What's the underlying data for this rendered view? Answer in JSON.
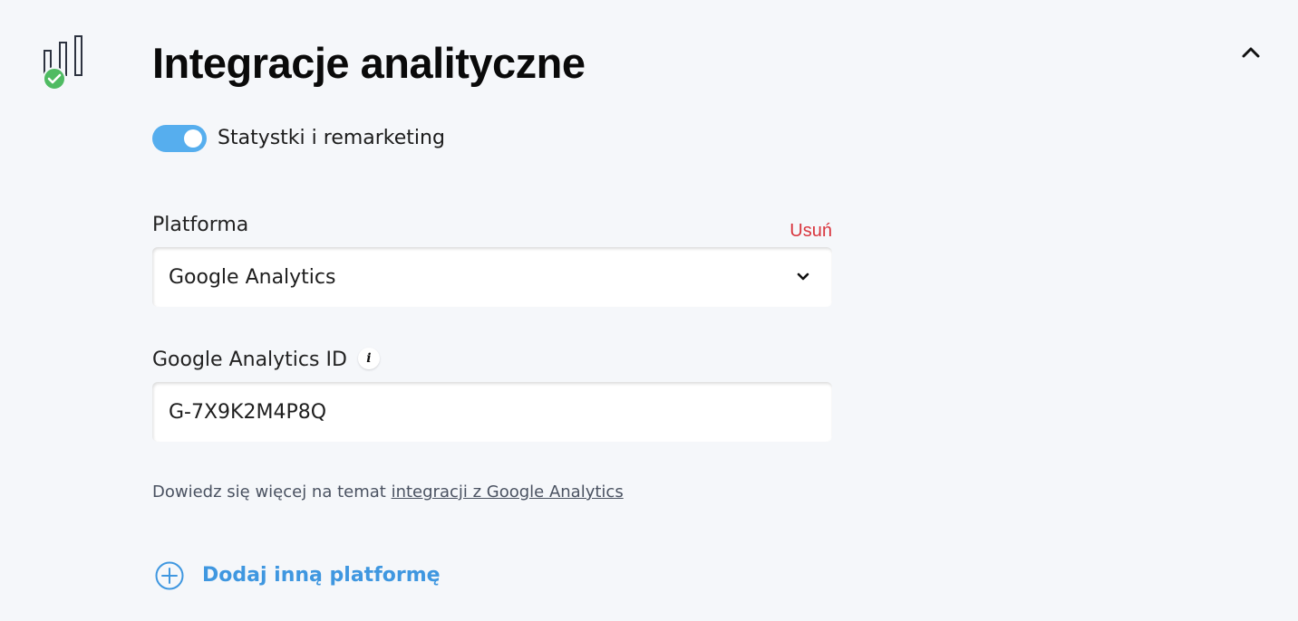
{
  "section": {
    "title": "Integracje analityczne",
    "icon": "bar-chart-check-icon"
  },
  "toggle": {
    "label": "Statystki i remarketing",
    "on": true
  },
  "platform": {
    "label": "Platforma",
    "remove_label": "Usuń",
    "selected": "Google Analytics"
  },
  "ga_id": {
    "label": "Google Analytics ID",
    "info_glyph": "i",
    "value": "G-7X9K2M4P8Q"
  },
  "help": {
    "prefix": "Dowiedz się więcej na temat ",
    "link": "integracji z Google Analytics"
  },
  "add_platform": {
    "label": "Dodaj inną platformę"
  },
  "colors": {
    "accent": "#3f97e0",
    "toggle_on": "#56aeee",
    "danger": "#d9363e",
    "success": "#4fbb62",
    "background": "#f5f7fa"
  }
}
